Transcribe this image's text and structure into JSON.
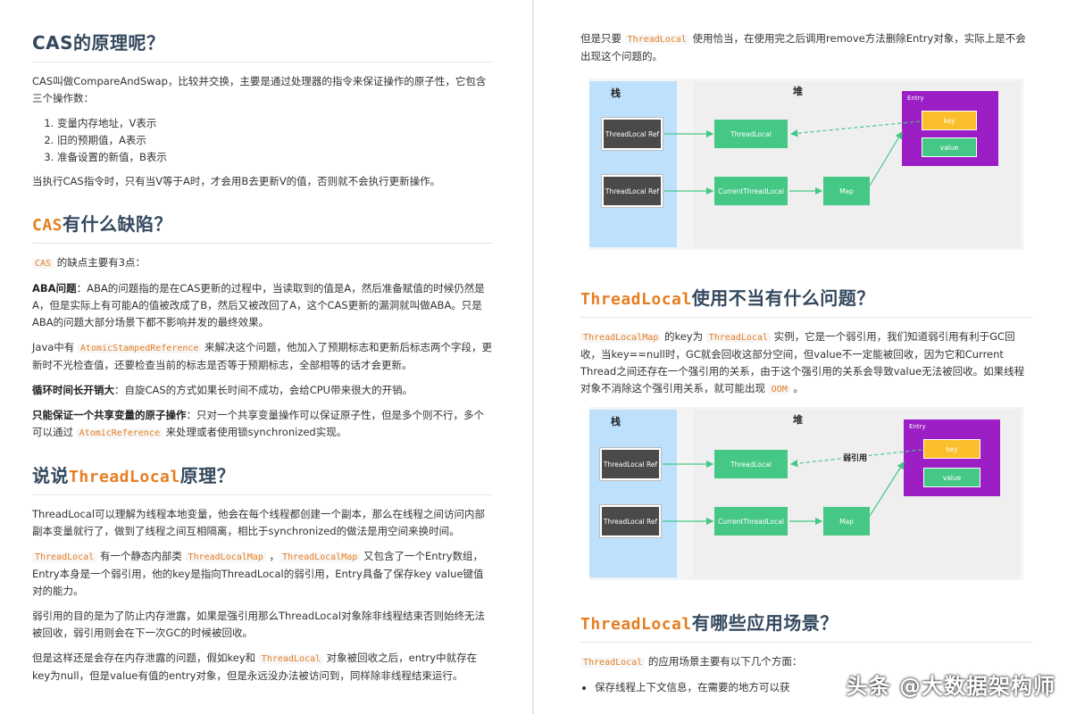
{
  "left": {
    "s1_title": "CAS的原理呢？",
    "s1_p1": "CAS叫做CompareAndSwap，比较并交换，主要是通过处理器的指令来保证操作的原子性，它包含三个操作数：",
    "s1_list": [
      "变量内存地址，V表示",
      "旧的预期值，A表示",
      "准备设置的新值，B表示"
    ],
    "s1_p2": "当执行CAS指令时，只有当V等于A时，才会用B去更新V的值，否则就不会执行更新操作。",
    "s2_title_code": "CAS",
    "s2_title_rest": "有什么缺陷？",
    "s2_intro_code": "CAS",
    "s2_intro_rest": " 的缺点主要有3点：",
    "aba_label": "ABA问题",
    "aba_text": "：ABA的问题指的是在CAS更新的过程中，当读取到的值是A，然后准备赋值的时候仍然是A，但是实际上有可能A的值被改成了B，然后又被改回了A，这个CAS更新的漏洞就叫做ABA。只是ABA的问题大部分场景下都不影响并发的最终效果。",
    "java_pre": "Java中有 ",
    "java_code": "AtomicStampedReference",
    "java_post": " 来解决这个问题，他加入了预期标志和更新后标志两个字段，更新时不光检查值，还要检查当前的标志是否等于预期标志，全部相等的话才会更新。",
    "loop_label": "循环时间长开销大",
    "loop_text": "：自旋CAS的方式如果长时间不成功，会给CPU带来很大的开销。",
    "single_label": "只能保证一个共享变量的原子操作",
    "single_text": "：只对一个共享变量操作可以保证原子性，但是多个则不行，多个可以通过 ",
    "single_code": "AtomicReference",
    "single_post": " 来处理或者使用锁synchronized实现。",
    "s3_title_pre": "说说",
    "s3_title_code": "ThreadLocal",
    "s3_title_post": "原理？",
    "tl_p1": "ThreadLocal可以理解为线程本地变量，他会在每个线程都创建一个副本，那么在线程之间访问内部副本变量就行了，做到了线程之间互相隔离，相比于synchronized的做法是用空间来换时间。",
    "tl_p2_code1": "ThreadLocal",
    "tl_p2_a": " 有一个静态内部类 ",
    "tl_p2_code2": "ThreadLocalMap",
    "tl_p2_b": " ，",
    "tl_p2_code3": "ThreadLocalMap",
    "tl_p2_c": " 又包含了一个Entry数组，Entry本身是一个弱引用，他的key是指向ThreadLocal的弱引用，Entry具备了保存key value键值对的能力。",
    "tl_p3": "弱引用的目的是为了防止内存泄露，如果是强引用那么ThreadLocal对象除非线程结束否则始终无法被回收，弱引用则会在下一次GC的时候被回收。",
    "tl_p4_a": "但是这样还是会存在内存泄露的问题，假如key和 ",
    "tl_p4_code": "ThreadLocal",
    "tl_p4_b": " 对象被回收之后，entry中就存在key为null，但是value有值的entry对象，但是永远没办法被访问到，同样除非线程结束运行。"
  },
  "right": {
    "p1_a": "但是只要 ",
    "p1_code": "ThreadLocal",
    "p1_b": " 使用恰当，在使用完之后调用remove方法删除Entry对象，实际上是不会出现这个问题的。",
    "diagram1": {
      "stack": "栈",
      "heap": "堆",
      "entry": "Entry",
      "tlref": "ThreadLocal Ref",
      "ctref": "ThreadLocal Ref",
      "tl": "ThreadLocal",
      "ct": "CurrentThreadLocal",
      "map": "Map",
      "key": "key",
      "value": "value"
    },
    "s4_title_code": "ThreadLocal",
    "s4_title_rest": "使用不当有什么问题？",
    "s4_p_code1": "ThreadLocalMap",
    "s4_p_a": " 的key为 ",
    "s4_p_code2": "ThreadLocal",
    "s4_p_b": " 实例，它是一个弱引用，我们知道弱引用有利于GC回收，当key==null时，GC就会回收这部分空间，但value不一定能被回收，因为它和Current Thread之间还存在一个强引用的关系，由于这个强引用的关系会导致value无法被回收。如果线程对象不消除这个强引用关系，就可能出现 ",
    "s4_p_code3": "OOM",
    "s4_p_c": " 。",
    "diagram2": {
      "stack": "栈",
      "heap": "堆",
      "entry": "Entry",
      "tlref": "ThreadLocal Ref",
      "ctref": "ThreadLocal Ref",
      "tl": "ThreadLocal",
      "ct": "CurrentThreadLocal",
      "map": "Map",
      "key": "key",
      "value": "value",
      "weak": "弱引用"
    },
    "s5_title_code": "ThreadLocal",
    "s5_title_rest": "有哪些应用场景？",
    "s5_p_code": "ThreadLocal",
    "s5_p_rest": " 的应用场景主要有以下几个方面：",
    "s5_list": [
      "保存线程上下文信息，在需要的地方可以获"
    ]
  },
  "watermark": "头条 @大数据架构师"
}
